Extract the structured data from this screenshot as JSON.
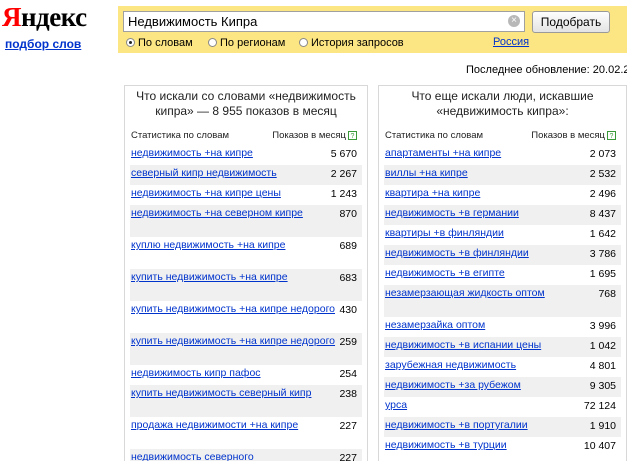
{
  "logo": {
    "accent": "Я",
    "rest": "ндекс"
  },
  "sublink": "подбор слов",
  "search": {
    "value": "Недвижимость Кипра",
    "button": "Подобрать"
  },
  "modes": [
    {
      "label": "По словам",
      "selected": true
    },
    {
      "label": "По регионам",
      "selected": false
    },
    {
      "label": "История запросов",
      "selected": false
    }
  ],
  "region": "Россия",
  "updated": "Последнее обновление: 20.02.2014",
  "left": {
    "title": "Что искали со словами «недвижимость кипра» — 8 955 показов в месяц",
    "col_word": "Статистика по словам",
    "col_count": "Показов в месяц",
    "rows": [
      {
        "w": "недвижимость +на кипре",
        "n": "5 670",
        "h": 20
      },
      {
        "w": "северный кипр недвижимость",
        "n": "2 267",
        "h": 20
      },
      {
        "w": "недвижимость +на кипре цены",
        "n": "1 243",
        "h": 20
      },
      {
        "w": "недвижимость +на северном кипре",
        "n": "870",
        "h": 32
      },
      {
        "w": "куплю недвижимость +на кипре",
        "n": "689",
        "h": 32
      },
      {
        "w": "купить недвижимость +на кипре",
        "n": "683",
        "h": 32
      },
      {
        "w": "купить недвижимость +на кипре недорого",
        "n": "430",
        "h": 32
      },
      {
        "w": "купить недвижимость +на кипре недорого",
        "n": "259",
        "h": 32
      },
      {
        "w": "недвижимость кипр пафос",
        "n": "254",
        "h": 20
      },
      {
        "w": "купить недвижимость северный кипр",
        "n": "238",
        "h": 32
      },
      {
        "w": "продажа недвижимости +на кипре",
        "n": "227",
        "h": 32
      },
      {
        "w": "недвижимость северного",
        "n": "227",
        "h": 20
      }
    ]
  },
  "right": {
    "title": "Что еще искали люди, искавшие «недвижимость кипра»:",
    "col_word": "Статистика по словам",
    "col_count": "Показов в месяц",
    "rows": [
      {
        "w": "апартаменты +на кипре",
        "n": "2 073",
        "h": 20
      },
      {
        "w": "виллы +на кипре",
        "n": "2 532",
        "h": 20
      },
      {
        "w": "квартира +на кипре",
        "n": "2 496",
        "h": 20
      },
      {
        "w": "недвижимость +в германии",
        "n": "8 437",
        "h": 20
      },
      {
        "w": "квартиры +в финляндии",
        "n": "1 642",
        "h": 20
      },
      {
        "w": "недвижимость +в финляндии",
        "n": "3 786",
        "h": 20
      },
      {
        "w": "недвижимость +в египте",
        "n": "1 695",
        "h": 20
      },
      {
        "w": "незамерзающая жидкость оптом",
        "n": "768",
        "h": 32
      },
      {
        "w": "незамерзайка оптом",
        "n": "3 996",
        "h": 20
      },
      {
        "w": "недвижимость +в испании цены",
        "n": "1 042",
        "h": 20
      },
      {
        "w": "зарубежная недвижимость",
        "n": "4 801",
        "h": 20
      },
      {
        "w": "недвижимость +за рубежом",
        "n": "9 305",
        "h": 20
      },
      {
        "w": "урса",
        "n": "72 124",
        "h": 20
      },
      {
        "w": "недвижимость +в португалии",
        "n": "1 910",
        "h": 20
      },
      {
        "w": "недвижимость +в турции",
        "n": "10 407",
        "h": 20
      }
    ]
  }
}
